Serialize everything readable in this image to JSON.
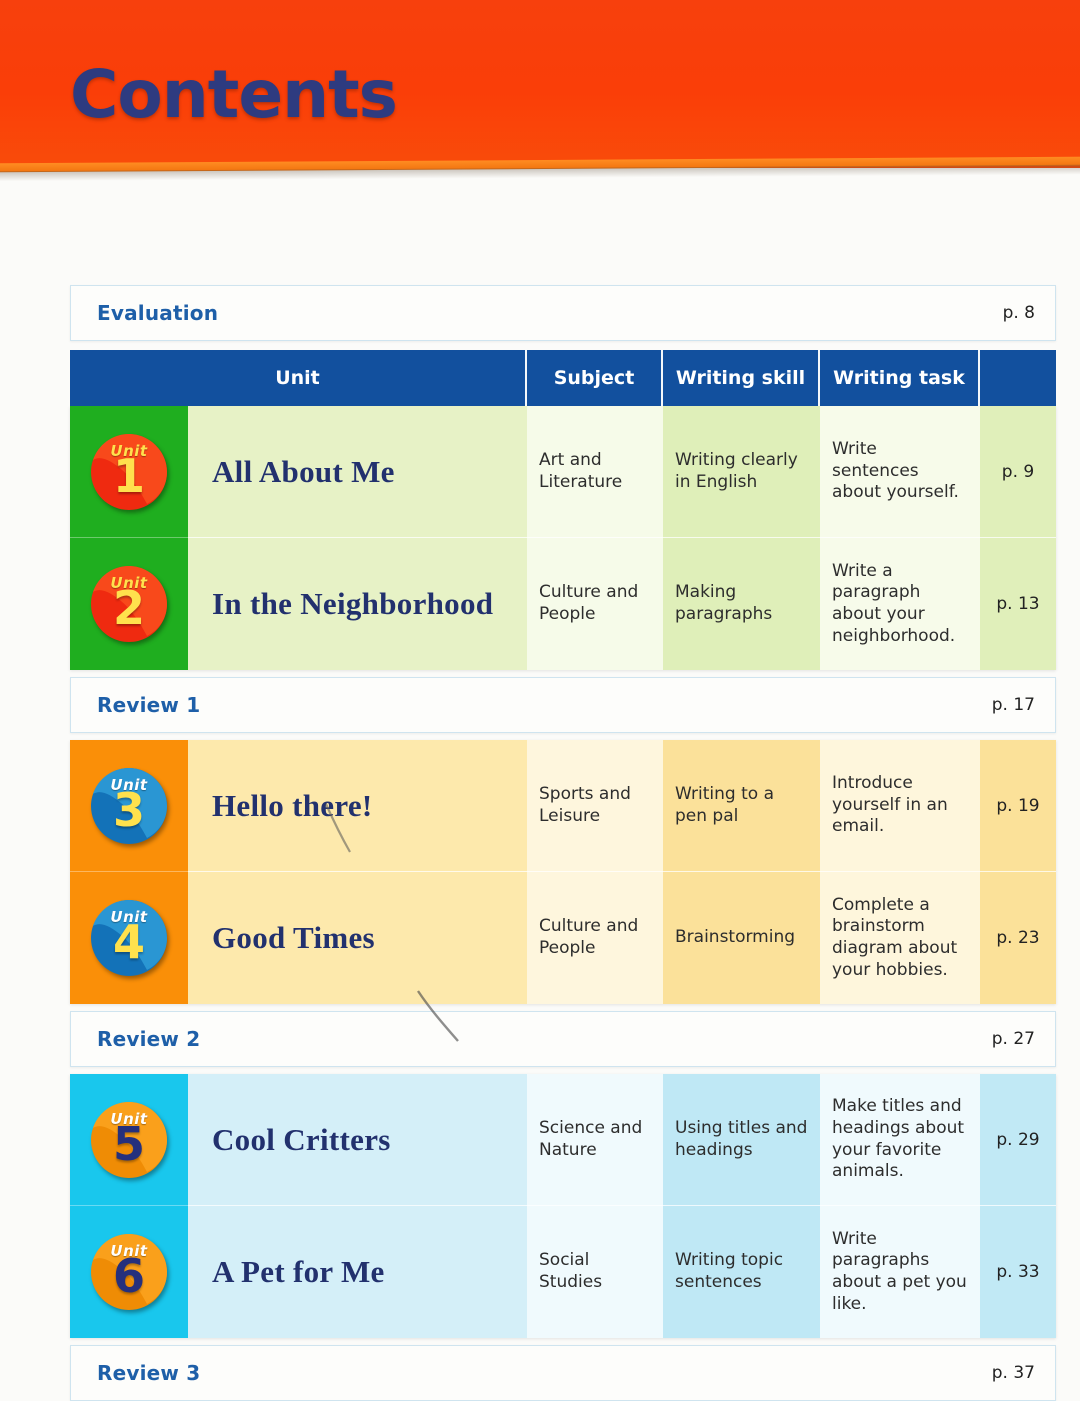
{
  "banner": {
    "title": "Contents"
  },
  "evaluation": {
    "label": "Evaluation",
    "page": "p. 8"
  },
  "table": {
    "headers": {
      "unit": "Unit",
      "subject": "Subject",
      "skill": "Writing skill",
      "task": "Writing task",
      "page": ""
    }
  },
  "blocks": [
    {
      "theme": "green",
      "badge_style": "bg-red",
      "units": [
        {
          "unit_word": "Unit",
          "number": "1",
          "title": "All About Me",
          "subject": "Art and Literature",
          "skill": "Writing clearly in English",
          "task": "Write sentences about yourself.",
          "page": "p. 9"
        },
        {
          "unit_word": "Unit",
          "number": "2",
          "title": "In the Neighborhood",
          "subject": "Culture and People",
          "skill": "Making paragraphs",
          "task": "Write a paragraph about your neighborhood.",
          "page": "p. 13"
        }
      ],
      "review": {
        "label": "Review 1",
        "page": "p. 17"
      }
    },
    {
      "theme": "orange",
      "badge_style": "bg-cyan",
      "units": [
        {
          "unit_word": "Unit",
          "number": "3",
          "title": "Hello there!",
          "subject": "Sports and Leisure",
          "skill": "Writing to a pen pal",
          "task": "Introduce yourself in an email.",
          "page": "p. 19"
        },
        {
          "unit_word": "Unit",
          "number": "4",
          "title": "Good Times",
          "subject": "Culture and People",
          "skill": "Brainstorming",
          "task": "Complete a brainstorm diagram about your hobbies.",
          "page": "p. 23"
        }
      ],
      "review": {
        "label": "Review 2",
        "page": "p. 27"
      }
    },
    {
      "theme": "blue",
      "badge_style": "bg-orange",
      "units": [
        {
          "unit_word": "Unit",
          "number": "5",
          "title": "Cool Critters",
          "subject": "Science and Nature",
          "skill": "Using titles and headings",
          "task": "Make titles and headings about your favorite animals.",
          "page": "p. 29"
        },
        {
          "unit_word": "Unit",
          "number": "6",
          "title": "A Pet for Me",
          "subject": "Social Studies",
          "skill": "Writing topic sentences",
          "task": "Write paragraphs about a pet you like.",
          "page": "p. 33"
        }
      ],
      "review": {
        "label": "Review 3",
        "page": "p. 37"
      }
    }
  ],
  "colors": {
    "banner_bg": "#fa3e08",
    "banner_title": "#2e3b80",
    "header_bg": "#12509e",
    "green_band": "#1fae1f",
    "orange_band": "#fa8f08",
    "blue_band": "#19c7ed",
    "review_label": "#1e5fa8"
  }
}
